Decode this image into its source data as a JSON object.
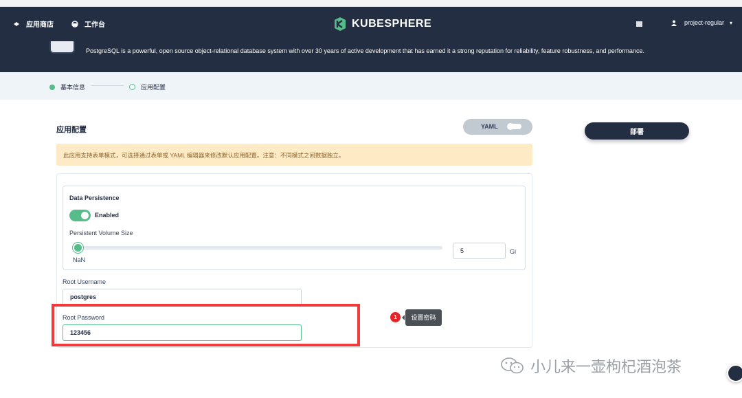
{
  "topbar": {
    "nav": [
      {
        "label": "应用商店",
        "icon": "app-store-icon"
      },
      {
        "label": "工作台",
        "icon": "workbench-icon"
      }
    ],
    "logo_text": "KUBESPHERE",
    "user_name": "project-regular",
    "caret": "▾"
  },
  "hero": {
    "description": "PostgreSQL is a powerful, open source object-relational database system with over 30 years of active development that has earned it a strong reputation for reliability, feature robustness, and performance."
  },
  "steps": [
    {
      "label": "基本信息",
      "state": "done"
    },
    {
      "label": "应用配置",
      "state": "current"
    }
  ],
  "config": {
    "title": "应用配置",
    "yaml_label": "YAML",
    "deploy_label": "部署",
    "notice": "此应用支持表单模式，可选择通过表单或 YAML 编辑器来修改默认应用配置。注意：不同模式之间数据独立。",
    "persistence": {
      "title": "Data Persistence",
      "enabled_label": "Enabled",
      "volume_label": "Persistent Volume Size",
      "slider_value_label": "NaN",
      "volume_value": "5",
      "unit": "Gi"
    },
    "username": {
      "label": "Root Username",
      "value": "postgres"
    },
    "password": {
      "label": "Root Password",
      "value": "123456"
    }
  },
  "annotation": {
    "number": "1",
    "tip": "设置密码",
    "highlight_color": "#ef3b3b"
  },
  "watermark": "小儿来一壶枸杞酒泡茶",
  "colors": {
    "topbar": "#242e42",
    "accent_green": "#55bc8a",
    "notice_bg": "#ffeac6"
  }
}
